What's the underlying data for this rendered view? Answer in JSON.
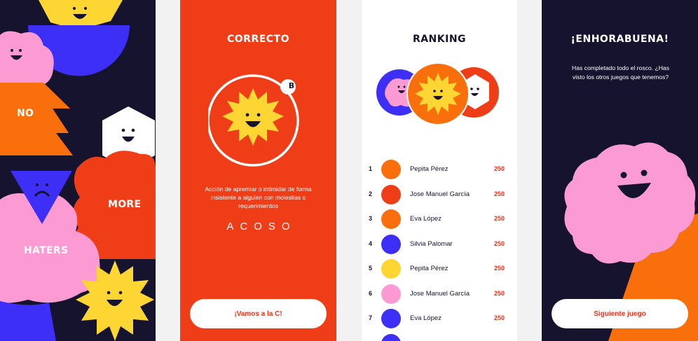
{
  "panel1": {
    "words": [
      "NO",
      "MORE",
      "HATERS"
    ]
  },
  "panel2": {
    "title": "CORRECTO",
    "letter": "B",
    "definition": "Acción de apremiar o intimidar de forma insistente a alguien con molestias o requerimientos",
    "answer": "ACOSO",
    "button": "¡Vamos a la C!"
  },
  "panel3": {
    "title": "RANKING",
    "rows": [
      {
        "rank": "1",
        "name": "Pepita Pérez",
        "score": "250",
        "color": "#f96f0c"
      },
      {
        "rank": "2",
        "name": "Jose Manuel García",
        "score": "250",
        "color": "#ef3d18"
      },
      {
        "rank": "3",
        "name": "Eva López",
        "score": "250",
        "color": "#f96f0c"
      },
      {
        "rank": "4",
        "name": "Silvia Palomar",
        "score": "250",
        "color": "#3d2ff5"
      },
      {
        "rank": "5",
        "name": "Pepita Pérez",
        "score": "250",
        "color": "#fdd634"
      },
      {
        "rank": "6",
        "name": "Jose Manuel García",
        "score": "250",
        "color": "#fb9ad3"
      },
      {
        "rank": "7",
        "name": "Eva López",
        "score": "250",
        "color": "#3d2ff5"
      }
    ]
  },
  "panel4": {
    "title": "¡ENHORABUENA!",
    "message": "Has completado todo el rosco. ¿Has visto los otros juegos que tenemos?",
    "button": "Siguiente juego"
  },
  "colors": {
    "navy": "#15132e",
    "red": "#ef3d18",
    "orange": "#f96f0c",
    "yellow": "#fdd634",
    "pink": "#fb9ad3",
    "blue": "#3d2ff5",
    "white": "#ffffff"
  }
}
